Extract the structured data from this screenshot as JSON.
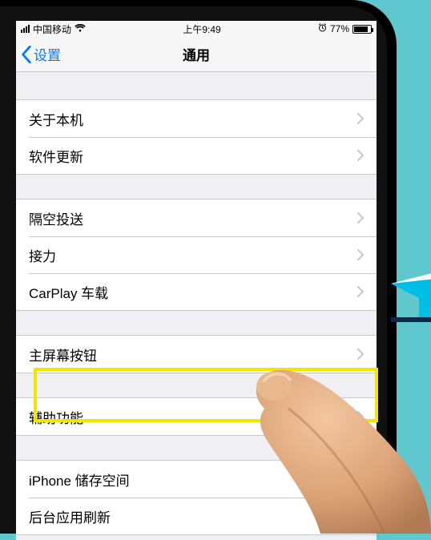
{
  "status": {
    "carrier": "中国移动",
    "time": "上午9:49",
    "battery_pct": "77%",
    "battery_fill_pct": 77
  },
  "nav": {
    "back_label": "设置",
    "title": "通用"
  },
  "groups": [
    {
      "rows": [
        {
          "label": "关于本机"
        },
        {
          "label": "软件更新"
        }
      ]
    },
    {
      "rows": [
        {
          "label": "隔空投送"
        },
        {
          "label": "接力"
        },
        {
          "label": "CarPlay 车载"
        }
      ]
    },
    {
      "rows": [
        {
          "label": "主屏幕按钮"
        }
      ]
    },
    {
      "rows": [
        {
          "label": "辅助功能"
        }
      ]
    },
    {
      "rows": [
        {
          "label": "iPhone 储存空间"
        },
        {
          "label": "后台应用刷新"
        }
      ]
    }
  ],
  "highlight_label": "辅助功能"
}
